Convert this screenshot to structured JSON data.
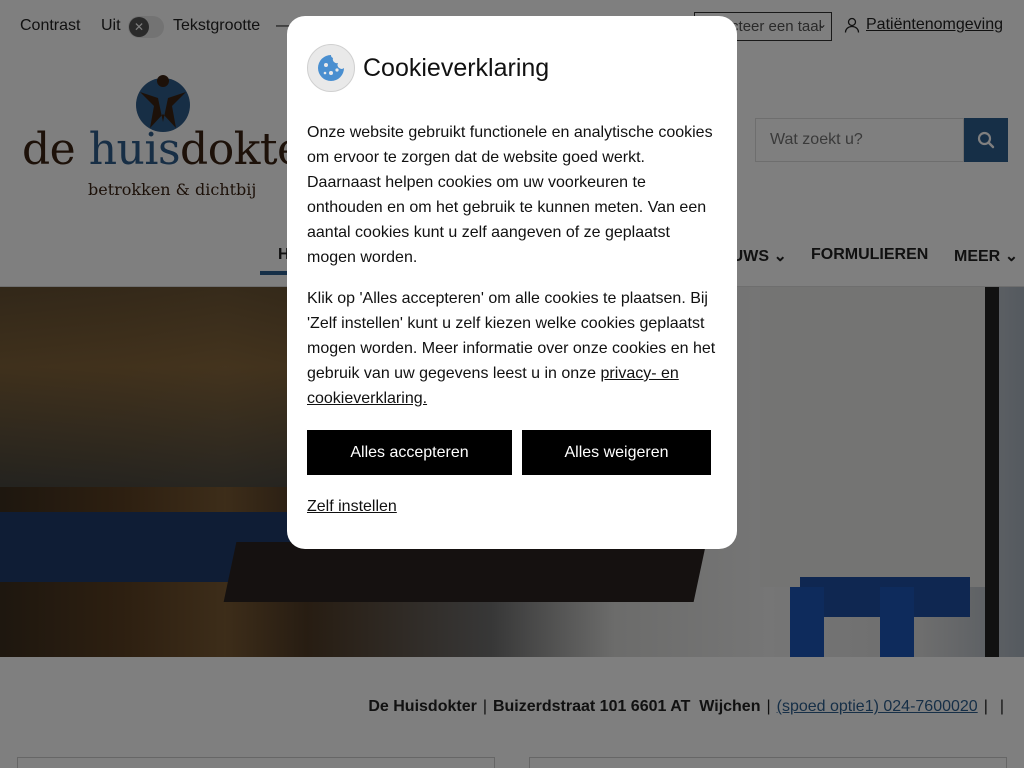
{
  "topbar": {
    "contrast_label": "Contrast",
    "contrast_state": "Uit",
    "fontsize_label": "Tekstgrootte",
    "fontsize_minus": "—",
    "language_placeholder": "Selecteer een taal",
    "patient_link": "Patiëntenomgeving"
  },
  "header": {
    "logo_word_a": "de ",
    "logo_word_b": "huis",
    "logo_word_c": "dokter",
    "logo_sub": "betrokken & dichtbij",
    "search_placeholder": "Wat zoekt u?"
  },
  "nav": {
    "items": [
      "HOME",
      "NIEUWS",
      "FORMULIEREN",
      "MEER"
    ]
  },
  "footer": {
    "name": "De Huisdokter",
    "street": "Buizerdstraat 101 6601 AT",
    "city": "Wijchen",
    "phone": "(spoed optie1) 024-7600020",
    "sep": "|"
  },
  "cookie_modal": {
    "title": "Cookieverklaring",
    "paragraph1": "Onze website gebruikt functionele en analytische cookies om ervoor te zorgen dat de website goed werkt. Daarnaast helpen cookies om uw voorkeuren te onthouden en om het gebruik te kunnen meten. Van een aantal cookies kunt u zelf aangeven of ze geplaatst mogen worden.",
    "paragraph2_text": "Klik op 'Alles accepteren' om alle cookies te plaatsen. Bij 'Zelf instellen' kunt u zelf kiezen welke cookies geplaatst mogen worden. Meer informatie over onze cookies en het gebruik van uw gegevens leest u in onze ",
    "privacy_link": "privacy- en cookieverklaring.",
    "accept_label": "Alles accepteren",
    "reject_label": "Alles weigeren",
    "custom_label": "Zelf instellen"
  },
  "colors": {
    "brand_blue": "#2d5f8f",
    "button_black": "#000000"
  }
}
